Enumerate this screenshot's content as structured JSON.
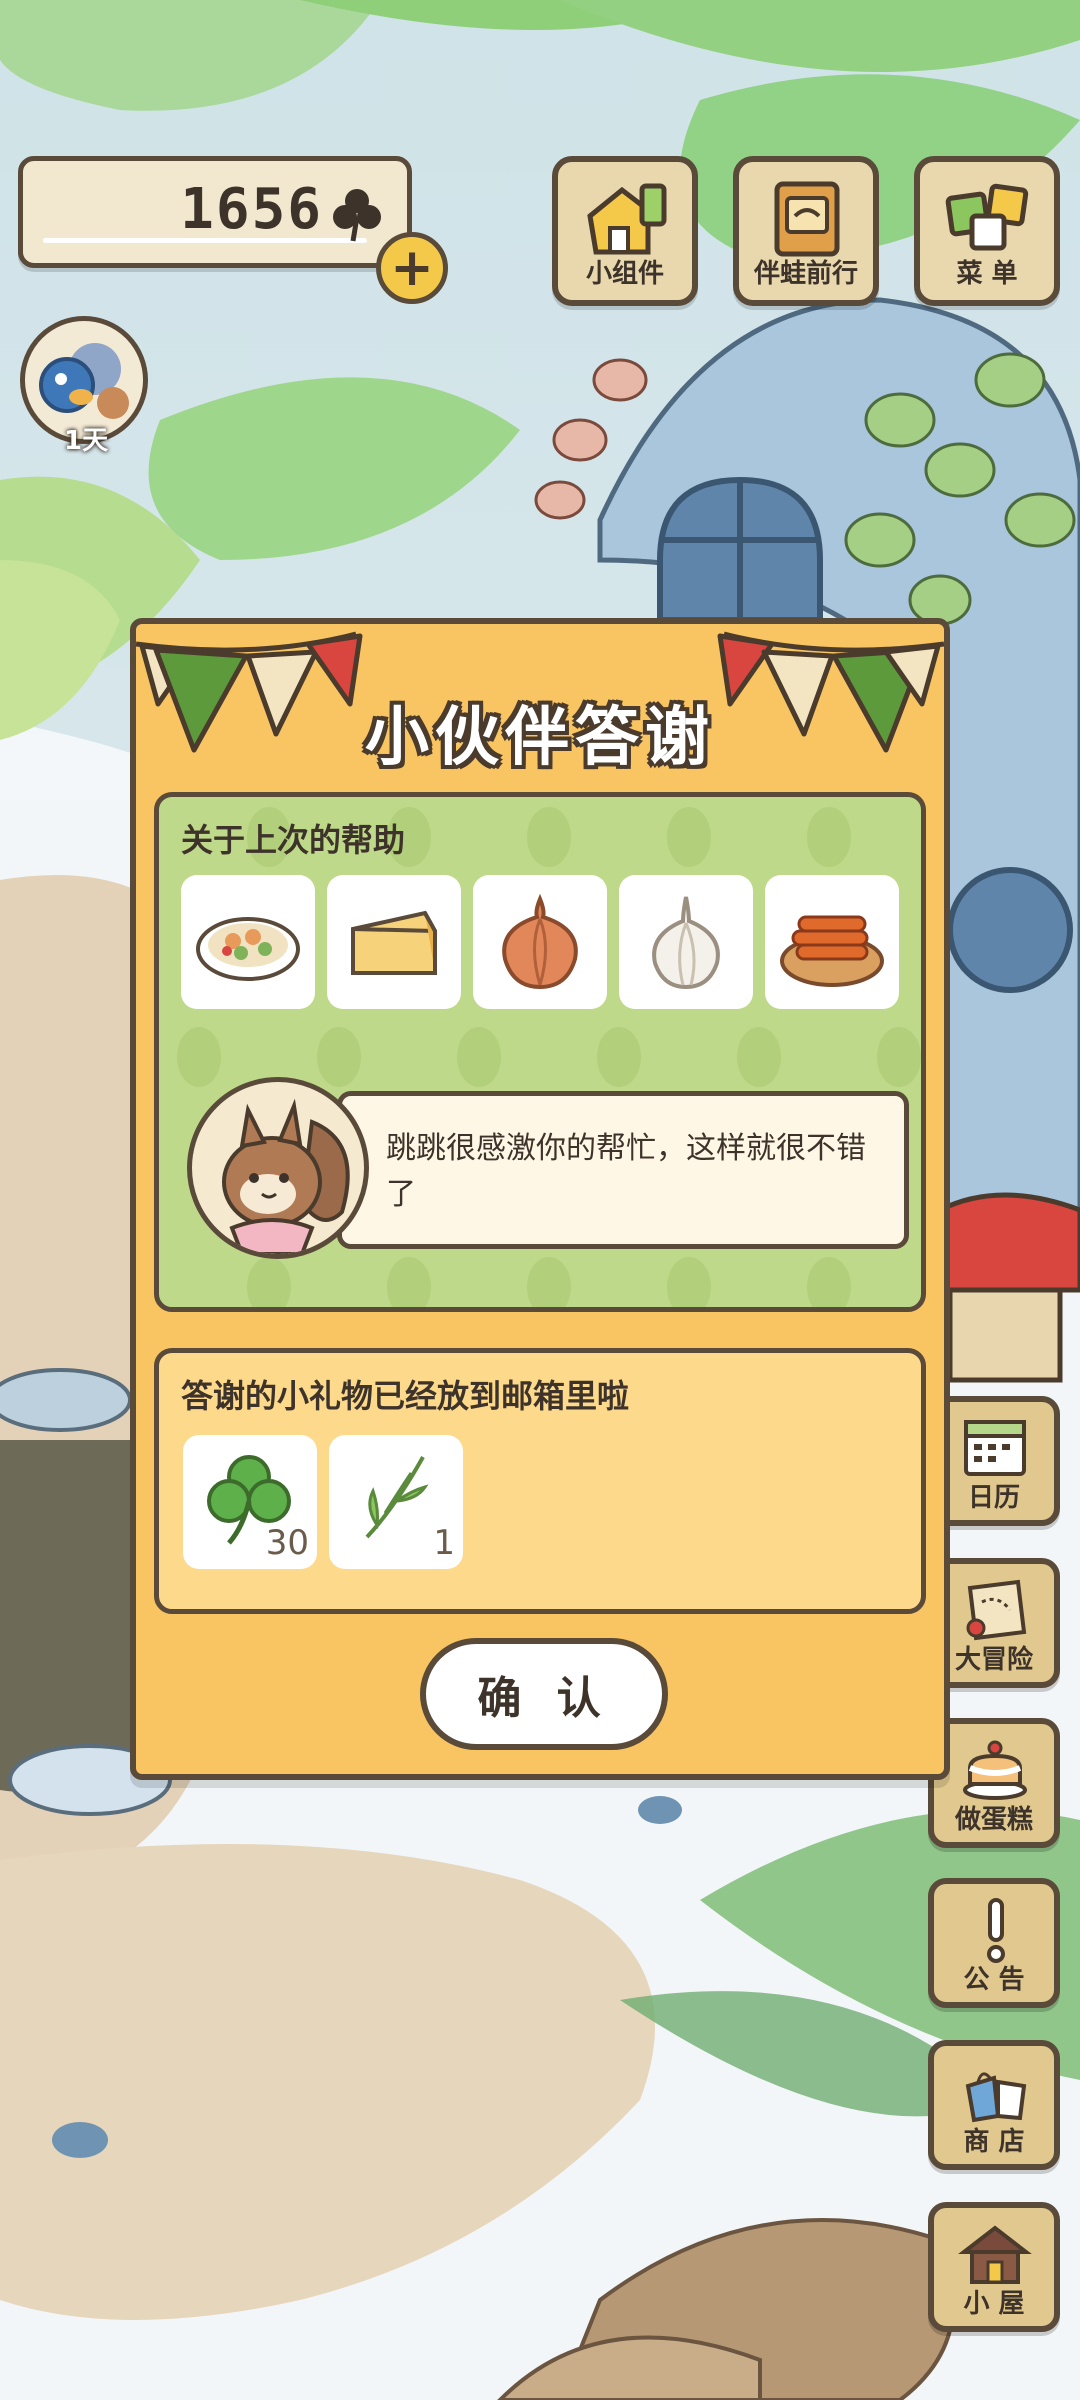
{
  "hud": {
    "clover_count": "1656",
    "add_label": "+",
    "avatar_days": "1天"
  },
  "top_buttons": [
    {
      "label": "小组件",
      "icon": "widget-icon"
    },
    {
      "label": "伴蛙前行",
      "icon": "journey-book-icon"
    },
    {
      "label": "菜 单",
      "icon": "menu-cards-icon"
    }
  ],
  "side_buttons": [
    {
      "label": "日历",
      "icon": "calendar-icon"
    },
    {
      "label": "大冒险",
      "icon": "adventure-map-icon"
    },
    {
      "label": "做蛋糕",
      "icon": "cake-icon"
    },
    {
      "label": "公 告",
      "icon": "notice-icon"
    },
    {
      "label": "商 店",
      "icon": "shop-icon"
    },
    {
      "label": "小 屋",
      "icon": "house-icon"
    }
  ],
  "dialog": {
    "title": "小伙伴答谢",
    "help_heading": "关于上次的帮助",
    "help_items": [
      {
        "icon": "salad-plate-icon"
      },
      {
        "icon": "cheese-icon"
      },
      {
        "icon": "onion-icon"
      },
      {
        "icon": "garlic-icon"
      },
      {
        "icon": "fried-dough-icon"
      }
    ],
    "speech_text": "跳跳很感激你的帮忙，这样就很不错了",
    "gift_heading": "答谢的小礼物已经放到邮箱里啦",
    "gifts": [
      {
        "icon": "clover-icon",
        "qty": "30"
      },
      {
        "icon": "grass-sprig-icon",
        "qty": "1"
      }
    ],
    "confirm_label": "确 认"
  },
  "colors": {
    "dialog_bg": "#f9c462",
    "help_panel_bg": "#bfd98a",
    "gift_panel_bg": "#fdd98c",
    "outline": "#5a4a3a",
    "flag_green": "#5d9a3c",
    "flag_red": "#d9534f"
  }
}
